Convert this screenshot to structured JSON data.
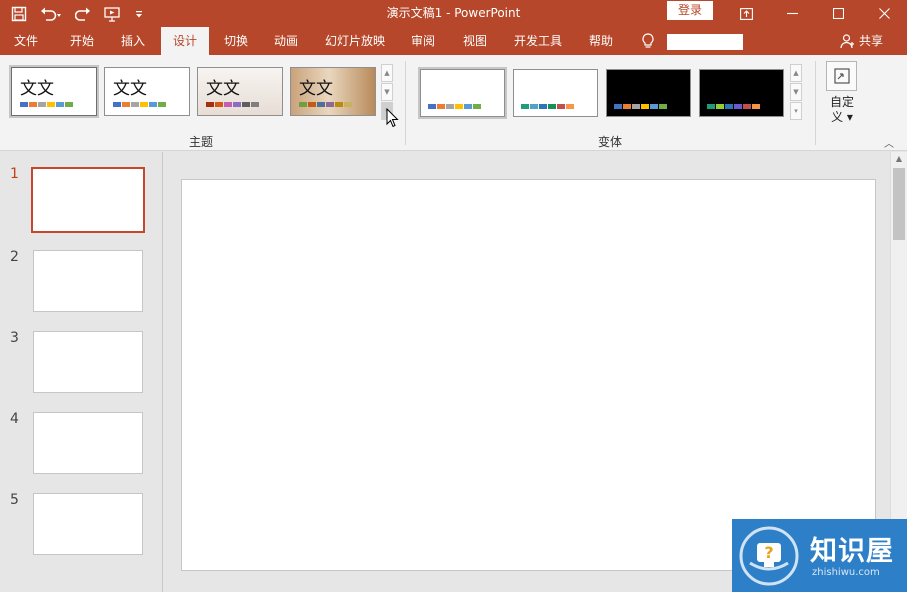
{
  "window": {
    "title": "演示文稿1  -  PowerPoint",
    "login_label": "登录"
  },
  "qat": {
    "icons": [
      "save-icon",
      "undo-icon",
      "redo-icon",
      "start-from-beginning-icon",
      "customize-qat-icon"
    ]
  },
  "tabs": [
    {
      "label": "文件"
    },
    {
      "label": "开始"
    },
    {
      "label": "插入"
    },
    {
      "label": "设计",
      "active": true
    },
    {
      "label": "切换"
    },
    {
      "label": "动画"
    },
    {
      "label": "幻灯片放映"
    },
    {
      "label": "审阅"
    },
    {
      "label": "视图"
    },
    {
      "label": "开发工具"
    },
    {
      "label": "帮助"
    }
  ],
  "share_label": "共享",
  "ribbon": {
    "themes_group_label": "主题",
    "variants_group_label": "变体",
    "customize_label": "自定义",
    "themes": [
      {
        "text": "文文",
        "selected": true,
        "colors": [
          "#4472c4",
          "#ed7d31",
          "#a5a5a5",
          "#ffc000",
          "#5b9bd5",
          "#70ad47"
        ]
      },
      {
        "text": "文文",
        "colors": [
          "#4472c4",
          "#ed7d31",
          "#a5a5a5",
          "#ffc000",
          "#5b9bd5",
          "#70ad47"
        ]
      },
      {
        "text": "文文",
        "colors": [
          "#a5300f",
          "#d55816",
          "#c35eb4",
          "#8e6cc2",
          "#5e5e5e",
          "#7f7f7f"
        ]
      },
      {
        "text": "文文",
        "colors": [
          "#6f9f41",
          "#c15b15",
          "#4e6e9b",
          "#8a6a9a",
          "#b88a0d",
          "#c9b25f"
        ]
      }
    ],
    "variants": [
      {
        "background": "#ffffff",
        "selected": true,
        "colors": [
          "#4472c4",
          "#ed7d31",
          "#a5a5a5",
          "#ffc000",
          "#5b9bd5",
          "#70ad47"
        ]
      },
      {
        "background": "#ffffff",
        "colors": [
          "#1f9c7a",
          "#4fa3c7",
          "#2e75b6",
          "#198e5b",
          "#c0504d",
          "#f79646"
        ]
      },
      {
        "background": "#000000",
        "colors": [
          "#4472c4",
          "#ed7d31",
          "#a5a5a5",
          "#ffc000",
          "#5b9bd5",
          "#70ad47"
        ]
      },
      {
        "background": "#000000",
        "colors": [
          "#1f9c7a",
          "#9acd32",
          "#2e75b6",
          "#6a5acd",
          "#c0504d",
          "#f79646"
        ]
      }
    ]
  },
  "slides": [
    {
      "number": "1",
      "active": true
    },
    {
      "number": "2"
    },
    {
      "number": "3"
    },
    {
      "number": "4"
    },
    {
      "number": "5"
    }
  ],
  "watermark": {
    "name": "知识屋",
    "url": "zhishiwu.com"
  },
  "colors": {
    "accent": "#b7472a",
    "ribbon_bg": "#f3f3f3",
    "workspace_bg": "#e6e6e6"
  }
}
